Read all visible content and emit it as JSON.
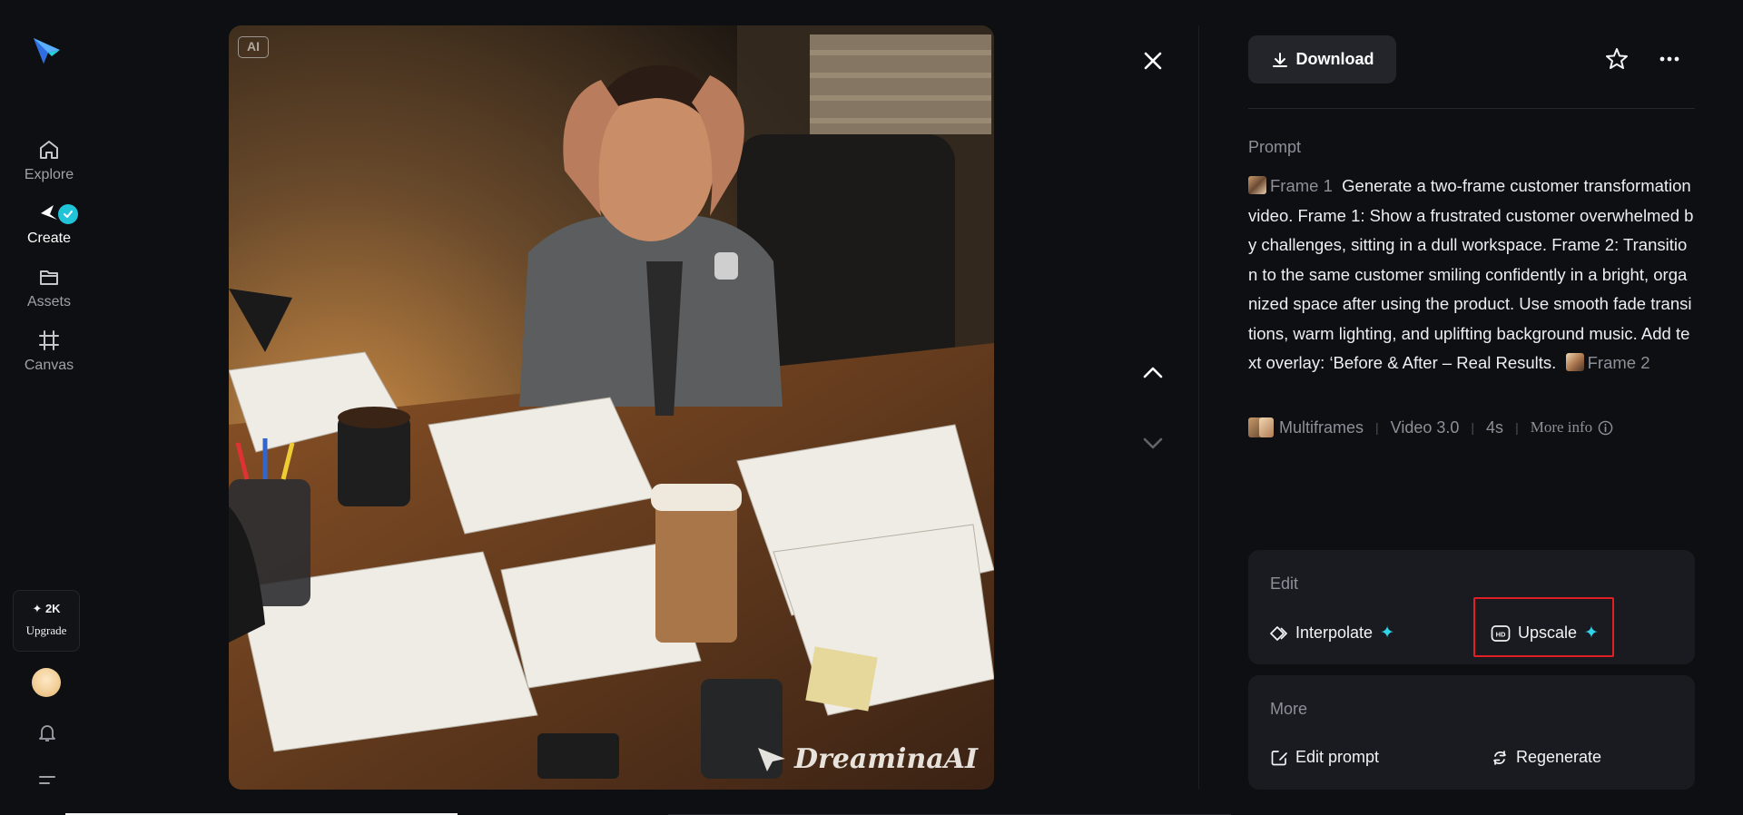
{
  "nav": {
    "items": [
      {
        "label": "Explore",
        "icon": "home-icon"
      },
      {
        "label": "Create",
        "icon": "create-icon",
        "active": true
      },
      {
        "label": "Assets",
        "icon": "folder-icon"
      },
      {
        "label": "Canvas",
        "icon": "canvas-icon"
      }
    ],
    "credits": "✦ 2K",
    "upgrade_label": "Upgrade"
  },
  "viewer": {
    "ai_badge": "AI",
    "watermark": "DreaminaAI"
  },
  "panel": {
    "download_label": "Download",
    "prompt_title": "Prompt",
    "frame1": "Frame 1",
    "frame2": "Frame 2",
    "prompt_text": "Generate a two-frame customer transformation video. Frame 1: Show a frustrated customer overwhelmed by challenges, sitting in a dull workspace. Frame 2: Transition to the same customer smiling confidently in a bright, organized space after using the product. Use smooth fade transitions, warm lighting, and uplifting background music. Add text overlay: ‘Before & After – Real Results.",
    "meta": {
      "mode": "Multiframes",
      "model": "Video 3.0",
      "duration": "4s",
      "more_info": "More info"
    },
    "edit": {
      "title": "Edit",
      "interpolate": "Interpolate",
      "upscale": "Upscale"
    },
    "more": {
      "title": "More",
      "edit_prompt": "Edit prompt",
      "regenerate": "Regenerate"
    }
  },
  "colors": {
    "accent": "#2fd4e8",
    "highlight_box": "#e02025",
    "background": "#0e0f12",
    "card": "#1a1b20"
  }
}
